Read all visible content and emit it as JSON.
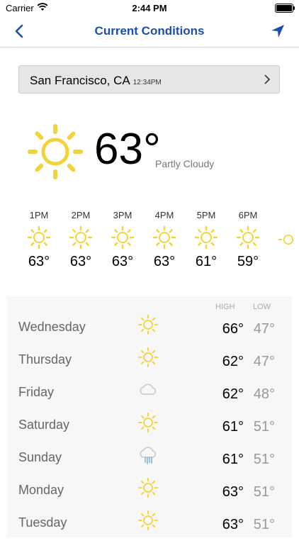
{
  "status": {
    "carrier": "Carrier",
    "time": "2:44 PM"
  },
  "nav": {
    "title": "Current Conditions"
  },
  "location": {
    "name": "San Francisco, CA",
    "time": "12:34PM"
  },
  "current": {
    "temp": "63°",
    "condition": "Partly Cloudy",
    "icon": "sun-icon"
  },
  "hourly": [
    {
      "time": "1PM",
      "temp": "63°",
      "icon": "sun-icon"
    },
    {
      "time": "2PM",
      "temp": "63°",
      "icon": "sun-icon"
    },
    {
      "time": "3PM",
      "temp": "63°",
      "icon": "sun-icon"
    },
    {
      "time": "4PM",
      "temp": "63°",
      "icon": "sun-icon"
    },
    {
      "time": "5PM",
      "temp": "61°",
      "icon": "sun-icon"
    },
    {
      "time": "6PM",
      "temp": "59°",
      "icon": "sun-icon"
    }
  ],
  "daily_headers": {
    "high": "HIGH",
    "low": "LOW"
  },
  "daily": [
    {
      "day": "Wednesday",
      "high": "66°",
      "low": "47°",
      "icon": "sun-icon"
    },
    {
      "day": "Thursday",
      "high": "62°",
      "low": "47°",
      "icon": "sun-icon"
    },
    {
      "day": "Friday",
      "high": "62°",
      "low": "48°",
      "icon": "cloud-icon"
    },
    {
      "day": "Saturday",
      "high": "61°",
      "low": "51°",
      "icon": "sun-icon"
    },
    {
      "day": "Sunday",
      "high": "61°",
      "low": "51°",
      "icon": "rain-cloud-icon"
    },
    {
      "day": "Monday",
      "high": "63°",
      "low": "51°",
      "icon": "sun-icon"
    },
    {
      "day": "Tuesday",
      "high": "63°",
      "low": "51°",
      "icon": "sun-icon"
    }
  ],
  "colors": {
    "accent": "#1a4fb0",
    "sun": "#f2d43a",
    "cloud": "#c8c8c8",
    "rain": "#8fb9d8"
  }
}
